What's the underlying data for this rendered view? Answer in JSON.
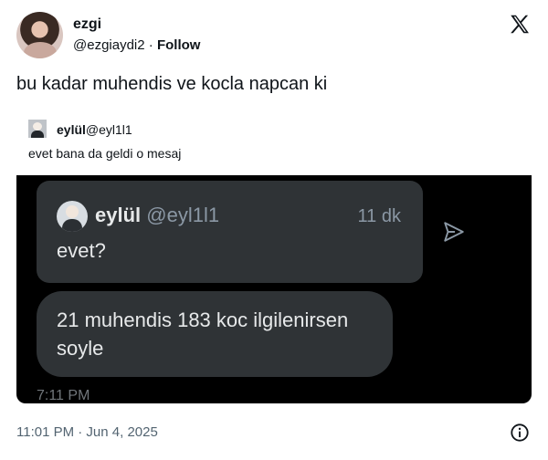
{
  "author": {
    "name": "ezgi",
    "handle": "@ezgiaydi2",
    "separator": "·",
    "follow": "Follow"
  },
  "tweet": {
    "text": "bu kadar muhendis ve kocla napcan ki",
    "timestamp": "11:01 PM · Jun 4, 2025"
  },
  "quoted": {
    "name": "eylül",
    "handle": "@eyl1l1",
    "text": "evet bana da geldi o mesaj"
  },
  "screenshot": {
    "bubble1": {
      "name": "eylül",
      "handle": "@eyl1l1",
      "time": "11 dk",
      "text": "evet?"
    },
    "bubble2": {
      "text": "21 muhendis 183 koc ilgilenirsen soyle"
    },
    "time": "7:11 PM"
  },
  "icons": [
    "x-logo-icon",
    "send-icon",
    "info-icon"
  ],
  "colors": {
    "dark_bg": "#000000",
    "bubble": "#2f3336",
    "muted": "#536471"
  }
}
